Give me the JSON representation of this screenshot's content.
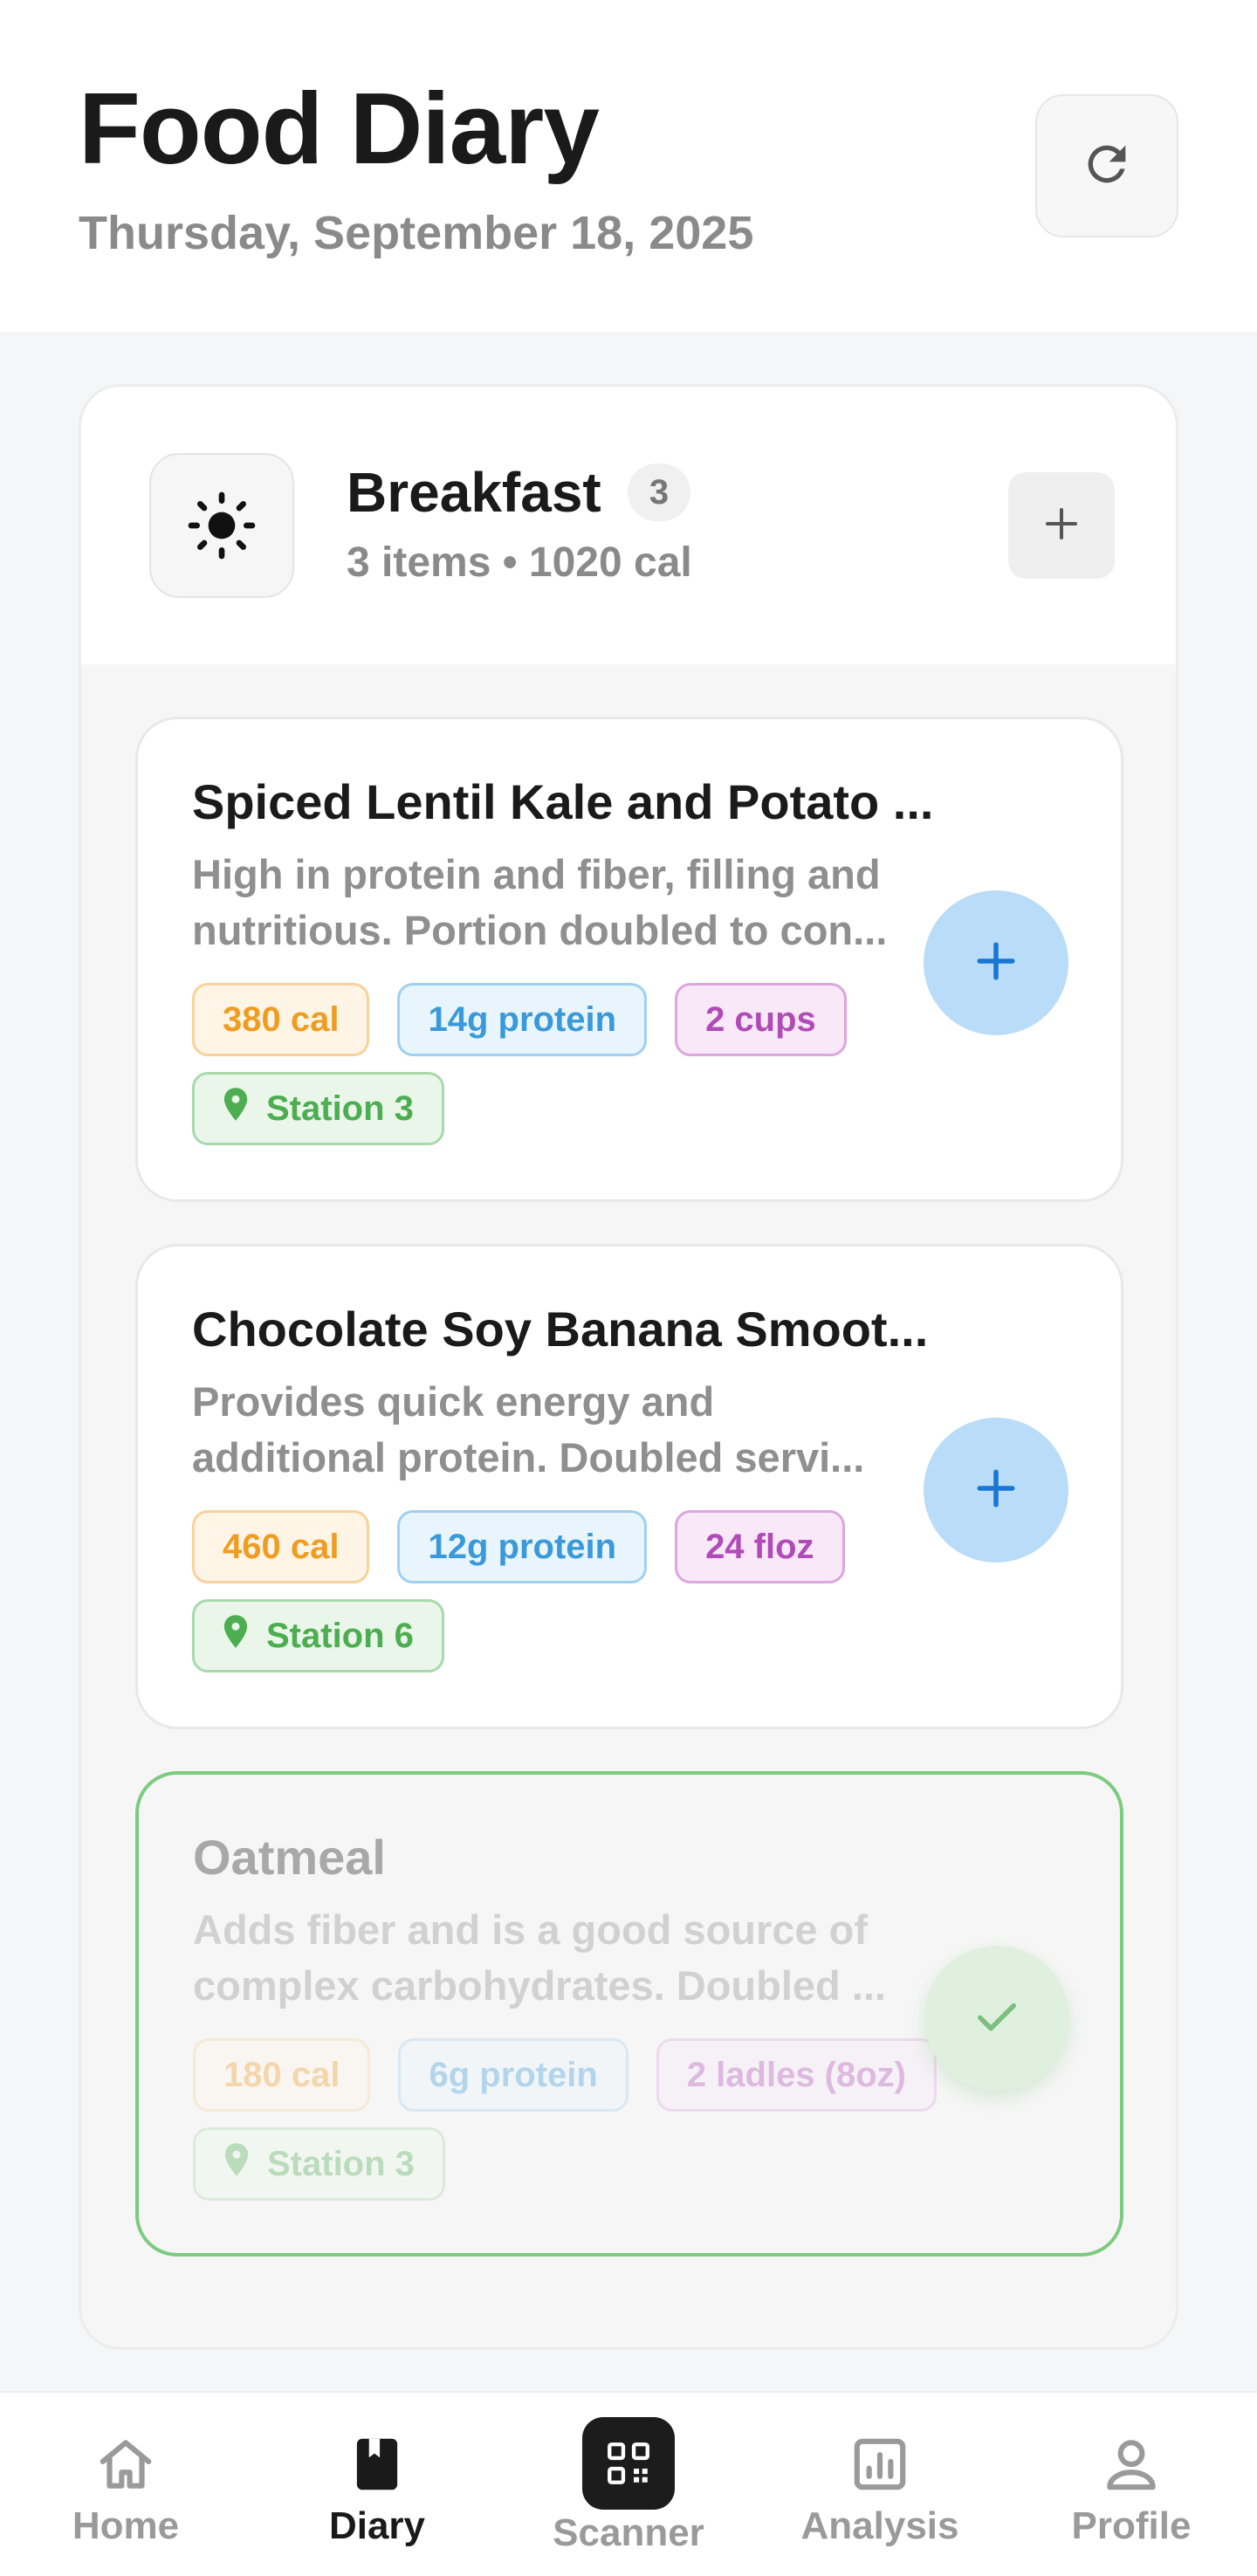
{
  "header": {
    "title": "Food Diary",
    "date": "Thursday, September 18, 2025",
    "refresh_icon": "refresh-icon"
  },
  "meal": {
    "title": "Breakfast",
    "count": "3",
    "summary": "3 items • 1020 cal",
    "icon": "sun-icon",
    "add_icon": "plus-icon"
  },
  "items": [
    {
      "title": "Spiced Lentil Kale and Potato ...",
      "desc_line1": "High in protein and fiber, filling and",
      "desc_line2": "nutritious. Portion doubled to con...",
      "calories": "380 cal",
      "protein": "14g protein",
      "portion": "2 cups",
      "station": "Station 3",
      "logged": false
    },
    {
      "title": "Chocolate Soy Banana Smoot...",
      "desc_line1": "Provides quick energy and",
      "desc_line2": "additional protein. Doubled servi...",
      "calories": "460 cal",
      "protein": "12g protein",
      "portion": "24 floz",
      "station": "Station 6",
      "logged": false
    },
    {
      "title": "Oatmeal",
      "desc_line1": "Adds fiber and is a good source of",
      "desc_line2": "complex carbohydrates. Doubled ...",
      "calories": "180 cal",
      "protein": "6g protein",
      "portion": "2 ladles (8oz)",
      "station": "Station 3",
      "logged": true
    }
  ],
  "nav": {
    "home": "Home",
    "diary": "Diary",
    "scanner": "Scanner",
    "analysis": "Analysis",
    "profile": "Profile",
    "active": "Diary"
  },
  "colors": {
    "accent_blue": "#1976d2",
    "add_button_bg": "#b9dcf8",
    "logged_border": "#7ccb7e",
    "calorie": "#ef9d22",
    "protein": "#3a9ad9",
    "portion": "#b04bb8",
    "station": "#4cae50"
  }
}
